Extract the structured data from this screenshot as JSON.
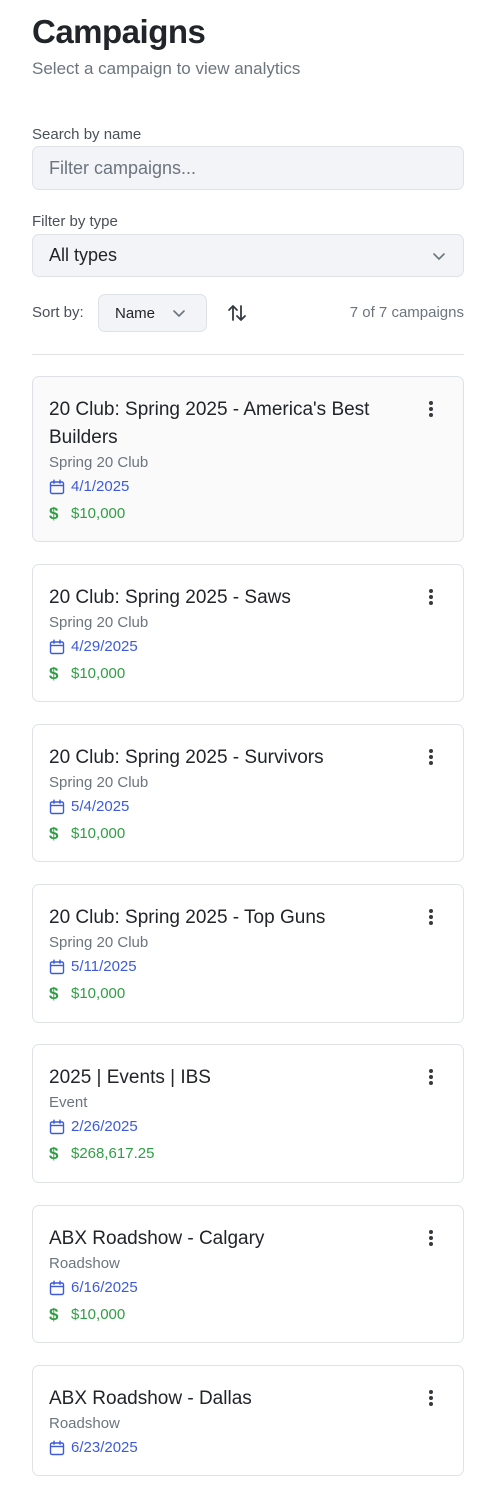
{
  "header": {
    "title": "Campaigns",
    "subtitle": "Select a campaign to view analytics"
  },
  "search": {
    "label": "Search by name",
    "placeholder": "Filter campaigns...",
    "value": ""
  },
  "filter": {
    "label": "Filter by type",
    "selected": "All types"
  },
  "sort": {
    "label": "Sort by:",
    "selected": "Name",
    "count_text": "7 of 7 campaigns"
  },
  "icons": {
    "chevron": "chevron-down-icon",
    "sort_toggle": "arrows-up-down-icon",
    "date": "calendar-icon",
    "amount": "dollar-icon",
    "menu": "kebab-menu-icon"
  },
  "colors": {
    "date_text": "#3d5bd9",
    "amount_text": "#2f9e44",
    "muted_text": "#6c757d"
  },
  "campaigns": [
    {
      "name": "20 Club: Spring 2025 - America's Best Builders",
      "type": "Spring 20 Club",
      "date": "4/1/2025",
      "amount": "$10,000"
    },
    {
      "name": "20 Club: Spring 2025 - Saws",
      "type": "Spring 20 Club",
      "date": "4/29/2025",
      "amount": "$10,000"
    },
    {
      "name": "20 Club: Spring 2025 - Survivors",
      "type": "Spring 20 Club",
      "date": "5/4/2025",
      "amount": "$10,000"
    },
    {
      "name": "20 Club: Spring 2025 - Top Guns",
      "type": "Spring 20 Club",
      "date": "5/11/2025",
      "amount": "$10,000"
    },
    {
      "name": "2025 | Events | IBS",
      "type": "Event",
      "date": "2/26/2025",
      "amount": "$268,617.25"
    },
    {
      "name": "ABX Roadshow - Calgary",
      "type": "Roadshow",
      "date": "6/16/2025",
      "amount": "$10,000"
    },
    {
      "name": "ABX Roadshow - Dallas",
      "type": "Roadshow",
      "date": "6/23/2025",
      "amount": null
    }
  ]
}
